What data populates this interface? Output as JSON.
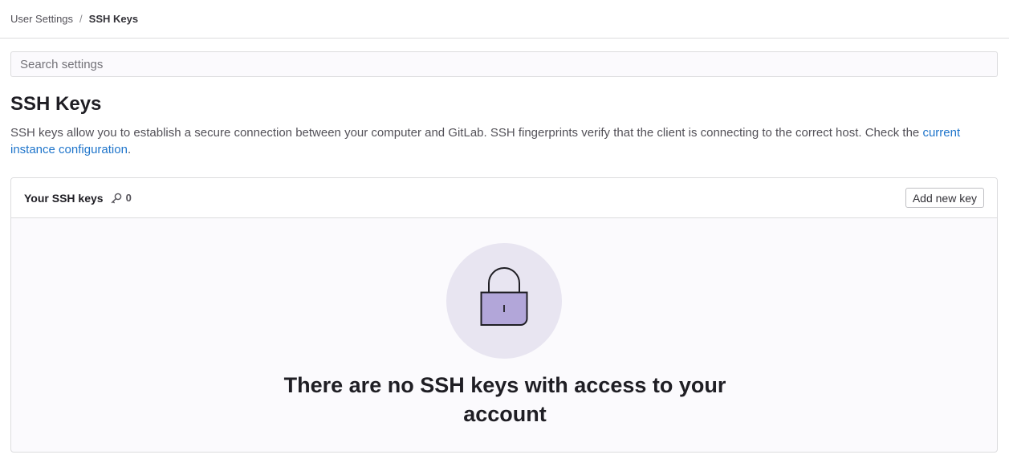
{
  "breadcrumb": {
    "parent": "User Settings",
    "separator": "/",
    "current": "SSH Keys"
  },
  "search": {
    "placeholder": "Search settings",
    "value": ""
  },
  "page": {
    "title": "SSH Keys",
    "description": "SSH keys allow you to establish a secure connection between your computer and GitLab. SSH fingerprints verify that the client is connecting to the correct host. Check the ",
    "description_link": "current instance configuration",
    "description_end": "."
  },
  "keys_card": {
    "title": "Your SSH keys",
    "count_icon": "key-icon",
    "count": "0",
    "add_button": "Add new key"
  },
  "empty_state": {
    "illustration": "padlock-icon",
    "title": "There are no SSH keys with access to your account"
  },
  "colors": {
    "link": "#1f75cb",
    "illustration_bg": "#e8e5f1",
    "padlock_body": "#b2a6d9"
  }
}
